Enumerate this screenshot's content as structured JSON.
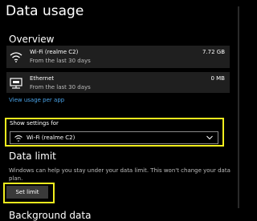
{
  "page": {
    "title": "Data usage"
  },
  "overview": {
    "heading": "Overview",
    "rows": [
      {
        "name": "Wi-Fi (realme C2)",
        "sub": "From the last 30 days",
        "amount": "7.72 GB",
        "icon": "wifi-icon"
      },
      {
        "name": "Ethernet",
        "sub": "From the last 30 days",
        "amount": "0 MB",
        "icon": "ethernet-icon"
      }
    ],
    "link": "View usage per app"
  },
  "settings": {
    "label": "Show settings for",
    "selected": "Wi-Fi (realme C2)"
  },
  "limit": {
    "heading": "Data limit",
    "description": "Windows can help you stay under your data limit. This won't change your data plan.",
    "button": "Set limit"
  },
  "next_section": {
    "heading": "Background data"
  },
  "colors": {
    "background": "#000000",
    "row": "#1f1f1f",
    "link": "#4aa3e8",
    "highlight": "#f2ee1e",
    "button": "#3a3a3a"
  }
}
